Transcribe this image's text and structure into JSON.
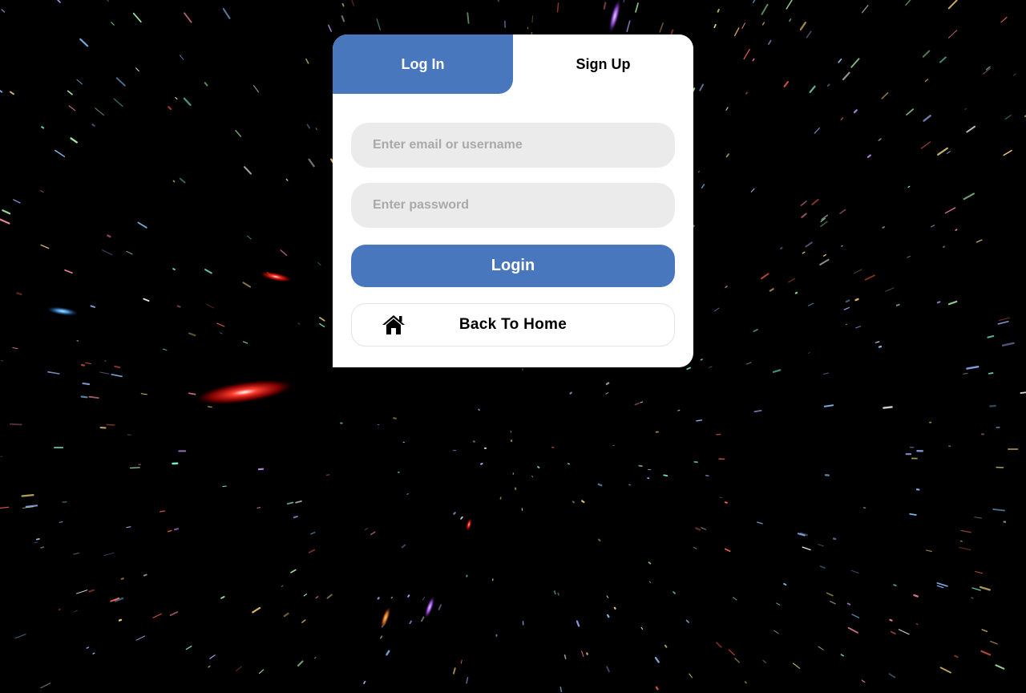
{
  "background": {
    "icon": "starfield-background",
    "color": "#000000"
  },
  "tabs": {
    "login_label": "Log In",
    "signup_label": "Sign Up",
    "active": "login"
  },
  "form": {
    "email_placeholder": "Enter email or username",
    "email_value": "",
    "password_placeholder": "Enter password",
    "password_value": "",
    "login_button_label": "Login",
    "home_button_label": "Back To Home",
    "home_icon": "home-icon"
  },
  "colors": {
    "accent": "#4877bd",
    "field_bg": "#ebebeb",
    "card_bg": "#ffffff"
  }
}
